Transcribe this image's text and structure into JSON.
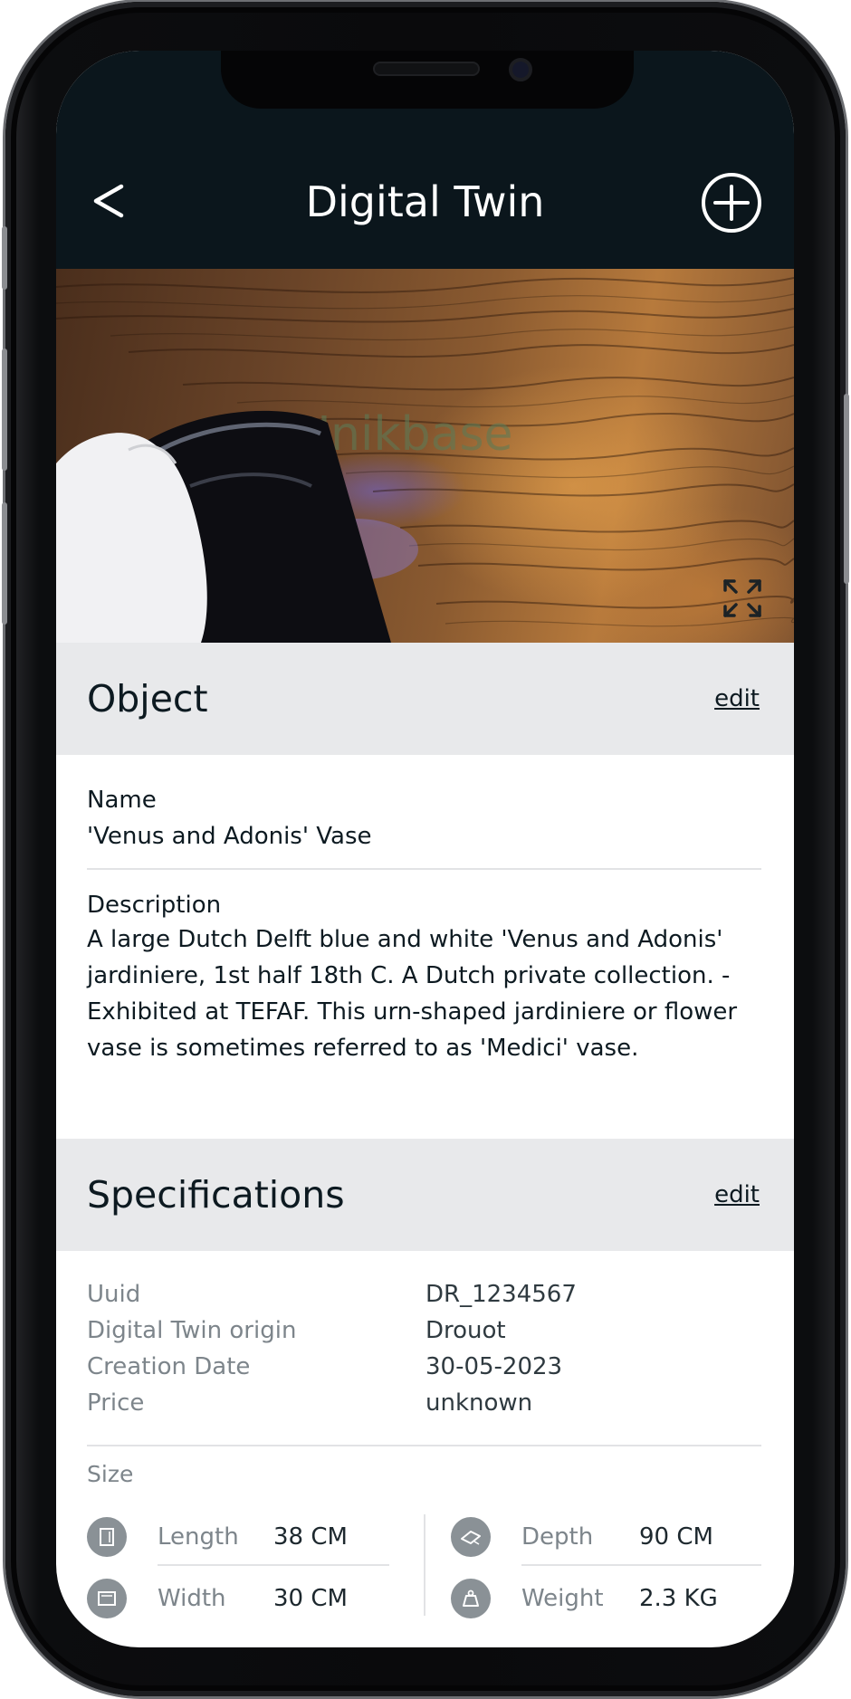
{
  "header": {
    "title": "Digital Twin",
    "back_icon": "chevron-left-icon",
    "add_icon": "plus-circle-icon"
  },
  "photo": {
    "description_icon": "expand-icon"
  },
  "object": {
    "title": "Object",
    "edit_label": "edit",
    "name_label": "Name",
    "name_value": "'Venus and Adonis' Vase",
    "description_label": "Description",
    "description_lines": [
      "A large Dutch Delft blue and white 'Venus and Adonis'",
      "jardiniere, 1st half 18th C. A Dutch private collection. -",
      "Exhibited at TEFAF. This urn-shaped jardiniere or flower",
      "vase is sometimes referred to as 'Medici' vase."
    ]
  },
  "specifications": {
    "title": "Specifications",
    "edit_label": "edit",
    "rows": [
      {
        "key": "Uuid",
        "value": "DR_1234567"
      },
      {
        "key": "Digital Twin origin",
        "value": "Drouot"
      },
      {
        "key": "Creation Date",
        "value": "30-05-2023"
      },
      {
        "key": "Price",
        "value": "unknown"
      }
    ],
    "size_label": "Size",
    "size": [
      {
        "key": "Length",
        "value": "38 CM",
        "icon": "length-icon"
      },
      {
        "key": "Width",
        "value": "30 CM",
        "icon": "width-icon"
      },
      {
        "key": "Depth",
        "value": "90 CM",
        "icon": "depth-icon"
      },
      {
        "key": "Weight",
        "value": "2.3 KG",
        "icon": "weight-icon"
      }
    ]
  },
  "colors": {
    "header_bg": "#0b161c",
    "section_bg": "#e8e9eb",
    "text": "#0d1a21",
    "muted": "#7d858b"
  }
}
